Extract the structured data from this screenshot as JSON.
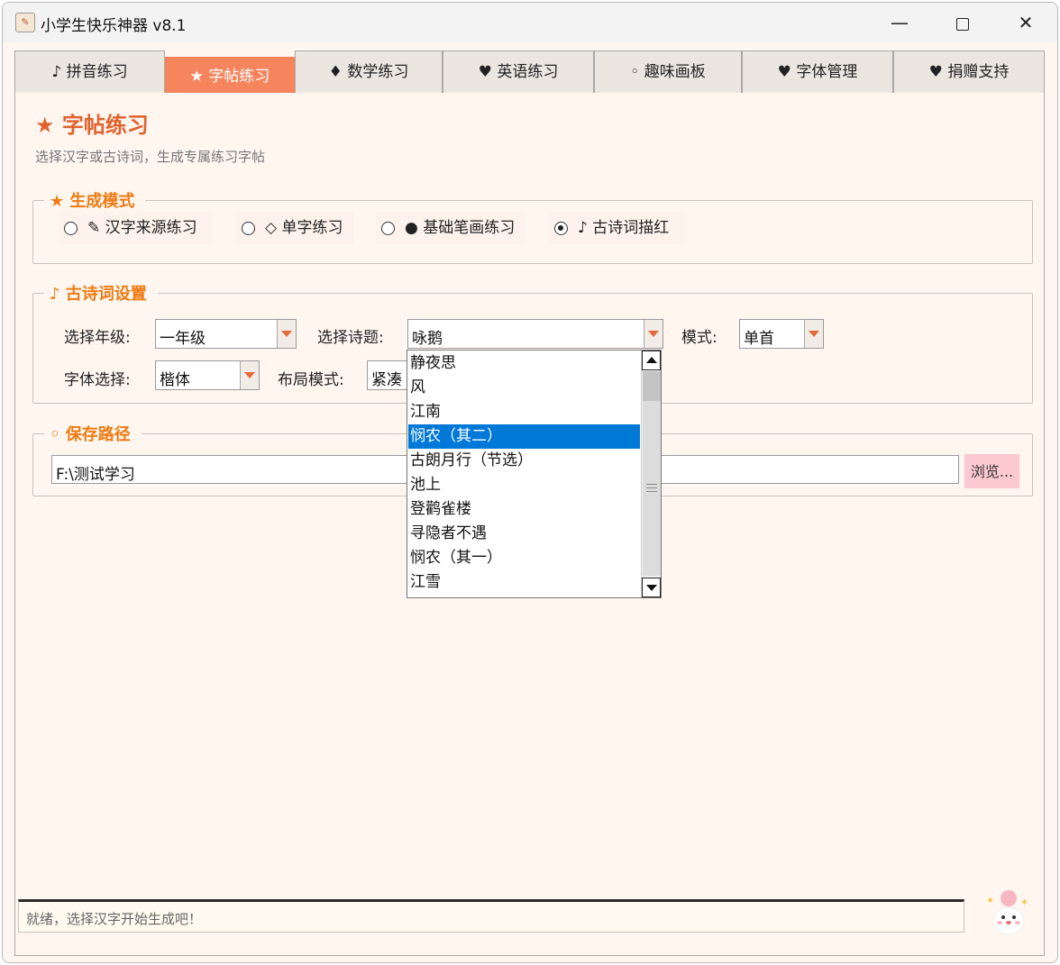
{
  "window": {
    "title": "小学生快乐神器 v8.1"
  },
  "titlebar": {
    "minimize": "—",
    "close": "✕"
  },
  "tabs": [
    {
      "label": "♪ 拼音练习"
    },
    {
      "label": "★ 字帖练习"
    },
    {
      "label": "♦ 数学练习"
    },
    {
      "label": "♥ 英语练习"
    },
    {
      "label": "◦ 趣味画板"
    },
    {
      "label": "♥ 字体管理"
    },
    {
      "label": "♥ 捐赠支持"
    }
  ],
  "page": {
    "title": "★ 字帖练习",
    "subtitle": "选择汉字或古诗词，生成专属练习字帖"
  },
  "mode": {
    "legend": "★ 生成模式",
    "options": [
      {
        "label": "✎ 汉字来源练习",
        "selected": false
      },
      {
        "label": "◇ 单字练习",
        "selected": false
      },
      {
        "label": "● 基础笔画练习",
        "selected": false
      },
      {
        "label": "♪ 古诗词描红",
        "selected": true
      }
    ]
  },
  "poem_settings": {
    "legend": "♪ 古诗词设置",
    "grade_label": "选择年级:",
    "grade_value": "一年级",
    "poem_label": "选择诗题:",
    "poem_value": "咏鹅",
    "mode_label": "模式:",
    "mode_value": "单首",
    "font_label": "字体选择:",
    "font_value": "楷体",
    "layout_label": "布局模式:",
    "layout_value": "紧凑"
  },
  "poem_dropdown": {
    "options": [
      "静夜思",
      "风",
      "江南",
      "悯农（其二）",
      "古朗月行（节选）",
      "池上",
      "登鹳雀楼",
      "寻隐者不遇",
      "悯农（其一）",
      "江雪"
    ],
    "selected": "悯农（其二）"
  },
  "save_path": {
    "legend": "◦ 保存路径",
    "value": "F:\\测试学习",
    "browse_label": "浏览..."
  },
  "status": {
    "text": "就绪，选择汉字开始生成吧！"
  },
  "colors": {
    "accent": "#f6855e",
    "legend": "#ef7a12",
    "title": "#e0622e",
    "selection": "#0078d7",
    "browse": "#fcc9d0"
  }
}
